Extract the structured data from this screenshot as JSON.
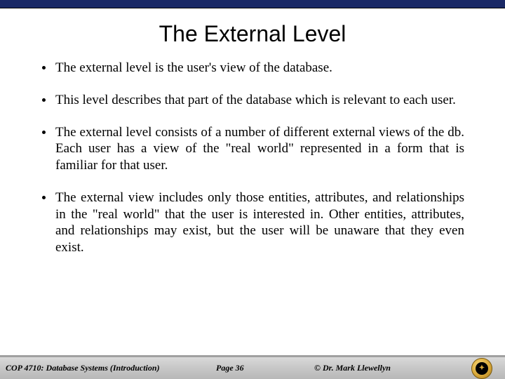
{
  "title": "The External Level",
  "bullets": [
    "The external level is the user's view of the database.",
    "This level describes that part of the database which is relevant to each user.",
    "The external level consists of a number of different external views of the db.  Each user has a view of the \"real world\" represented in a form that is familiar for that user.",
    "The external view includes only those entities, attributes, and relationships in the \"real world\" that the user is interested in.  Other entities, attributes, and relationships may exist, but the user will be unaware that they even exist."
  ],
  "footer": {
    "course": "COP 4710: Database Systems  (Introduction)",
    "page": "Page 36",
    "copyright": "©  Dr. Mark Llewellyn"
  }
}
